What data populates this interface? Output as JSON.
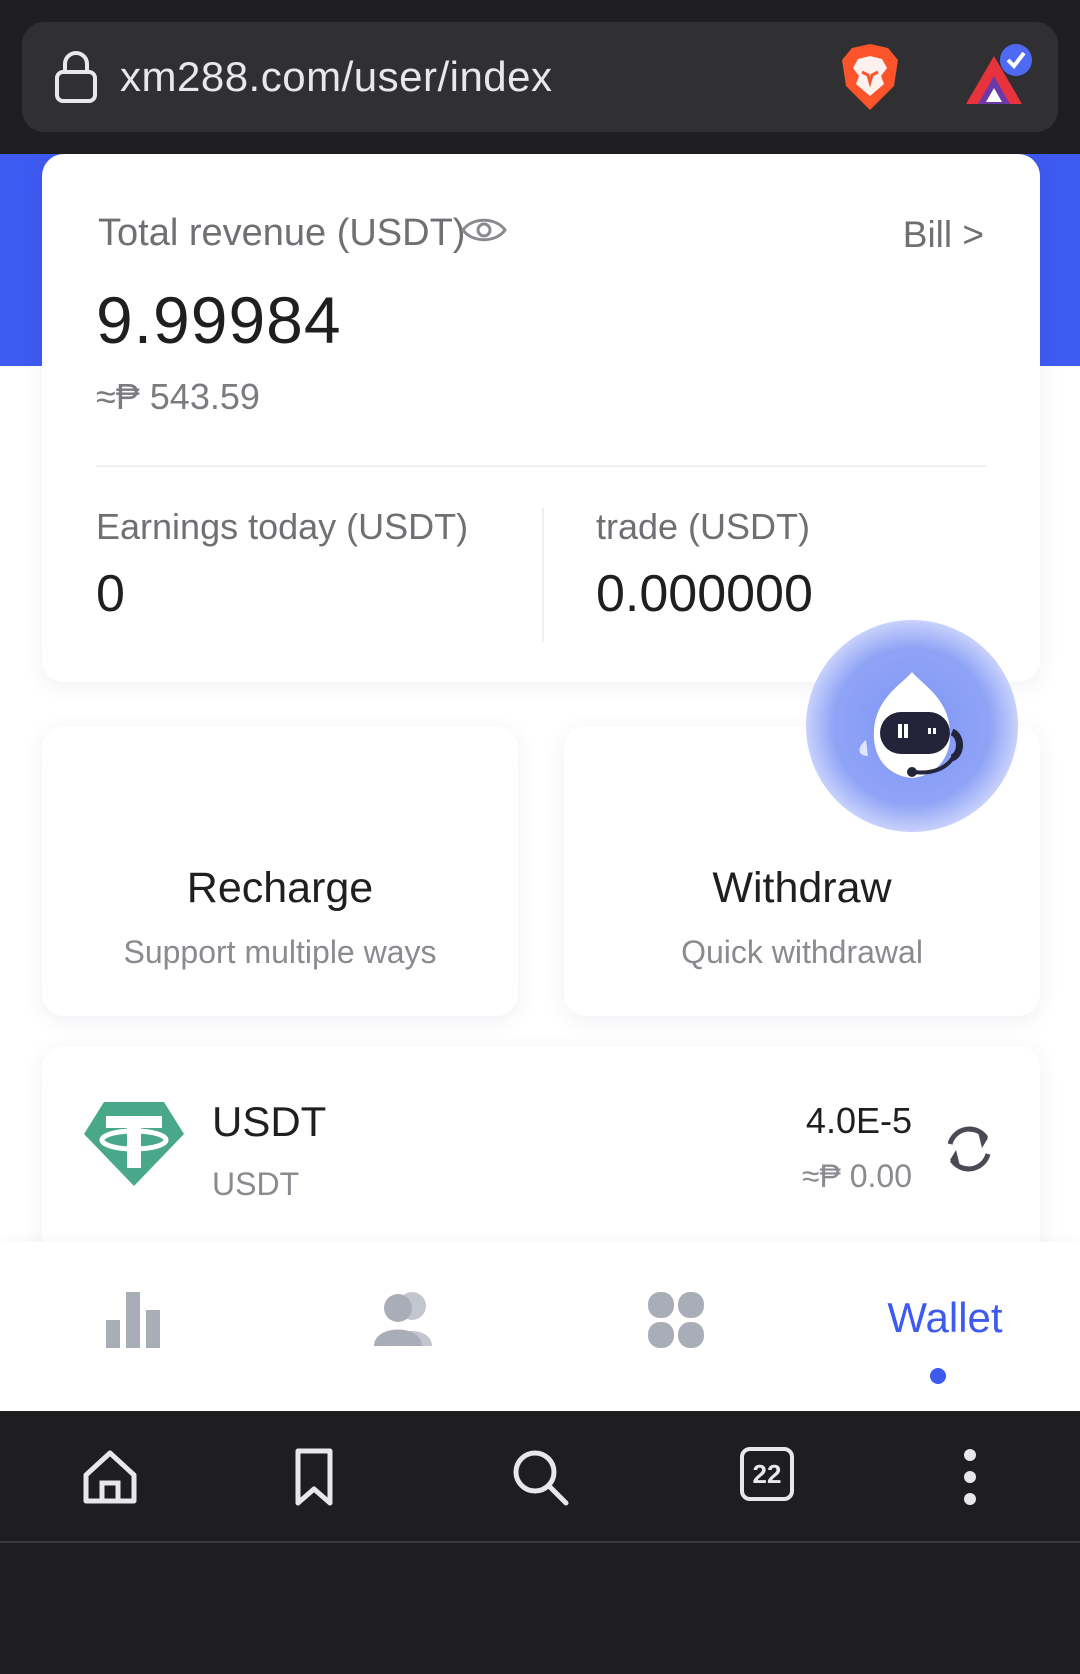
{
  "browser": {
    "url": "xm288.com/user/index",
    "tab_count": "22"
  },
  "summary": {
    "total_revenue_label": "Total revenue (USDT)",
    "bill_label": "Bill >",
    "total_revenue_value": "9.99984",
    "total_revenue_fiat": "≈₱ 543.59",
    "earnings_today_label": "Earnings today (USDT)",
    "earnings_today_value": "0",
    "trade_label": "trade (USDT)",
    "trade_value": "0.000000"
  },
  "actions": [
    {
      "title": "Recharge",
      "subtitle": "Support multiple ways"
    },
    {
      "title": "Withdraw",
      "subtitle": "Quick withdrawal"
    }
  ],
  "assets": [
    {
      "name": "USDT",
      "symbol": "USDT",
      "amount": "4.0E-5",
      "fiat": "≈₱ 0.00"
    }
  ],
  "tabbar": {
    "items": [
      {
        "icon": "bar-chart-icon"
      },
      {
        "icon": "people-icon"
      },
      {
        "icon": "apps-grid-icon"
      },
      {
        "icon": "wallet",
        "label": "Wallet",
        "active": true
      }
    ]
  },
  "colors": {
    "accent": "#3d5af1",
    "browser_bg": "#1e1e20",
    "tether_green": "#4aa88a",
    "brave_orange": "#fb542b"
  }
}
